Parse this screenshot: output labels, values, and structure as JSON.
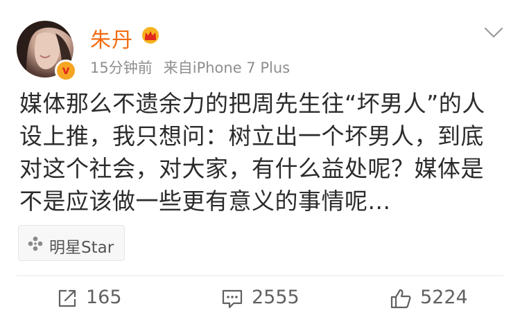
{
  "post": {
    "username": "朱丹",
    "time": "15分钟前",
    "source": "来自iPhone 7 Plus",
    "verified_badge": "v",
    "content": "媒体那么不遗余力的把周先生往“坏男人”的人设上推，我只想问：树立出一个坏男人，到底对这个社会，对大家，有什么益处呢？媒体是不是应该做一些更有意义的事情呢...",
    "tag": "明星Star",
    "icons": {
      "menu": "chevron-down-icon",
      "member": "crown-icon",
      "tag": "flower-icon",
      "repost": "repost-icon",
      "comment": "comment-icon",
      "like": "thumbs-up-icon"
    },
    "colors": {
      "username": "#f36b11",
      "crown": "#f6b21e",
      "badge": "#f6a623",
      "text": "#2b2b2b",
      "meta": "#8e8e8e"
    }
  },
  "actions": {
    "repost_count": "165",
    "comment_count": "2555",
    "like_count": "5224"
  }
}
